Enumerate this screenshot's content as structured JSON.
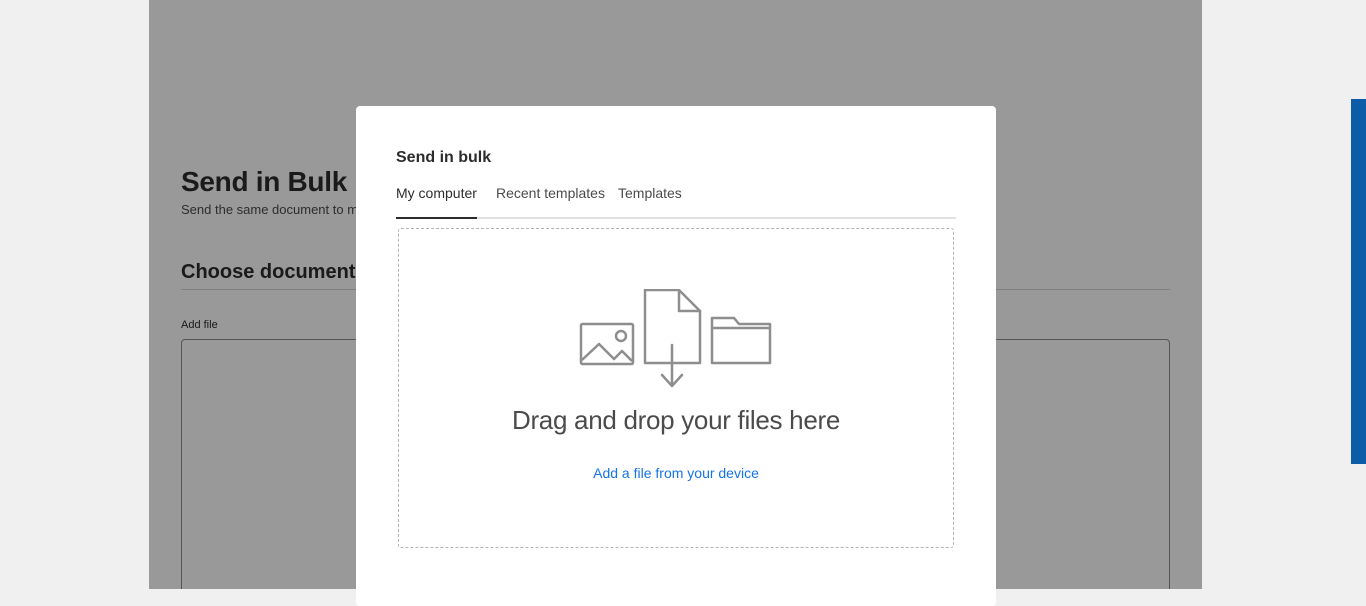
{
  "page": {
    "title": "Send in Bulk",
    "subtitle": "Send the same document to m",
    "section_title": "Choose documents",
    "add_file_label": "Add file"
  },
  "modal": {
    "title": "Send in bulk",
    "tabs": [
      {
        "label": "My computer",
        "active": true
      },
      {
        "label": "Recent templates",
        "active": false
      },
      {
        "label": "Templates",
        "active": false
      }
    ],
    "drop_zone": {
      "text": "Drag and drop your files here",
      "link": "Add a file from your device",
      "icons": [
        "image-icon",
        "document-download-icon",
        "folder-icon"
      ]
    }
  },
  "colors": {
    "overlay": "#000000",
    "link": "#1473e6",
    "side_bar": "#0c5ca8",
    "text_primary": "#2c2c2c"
  }
}
